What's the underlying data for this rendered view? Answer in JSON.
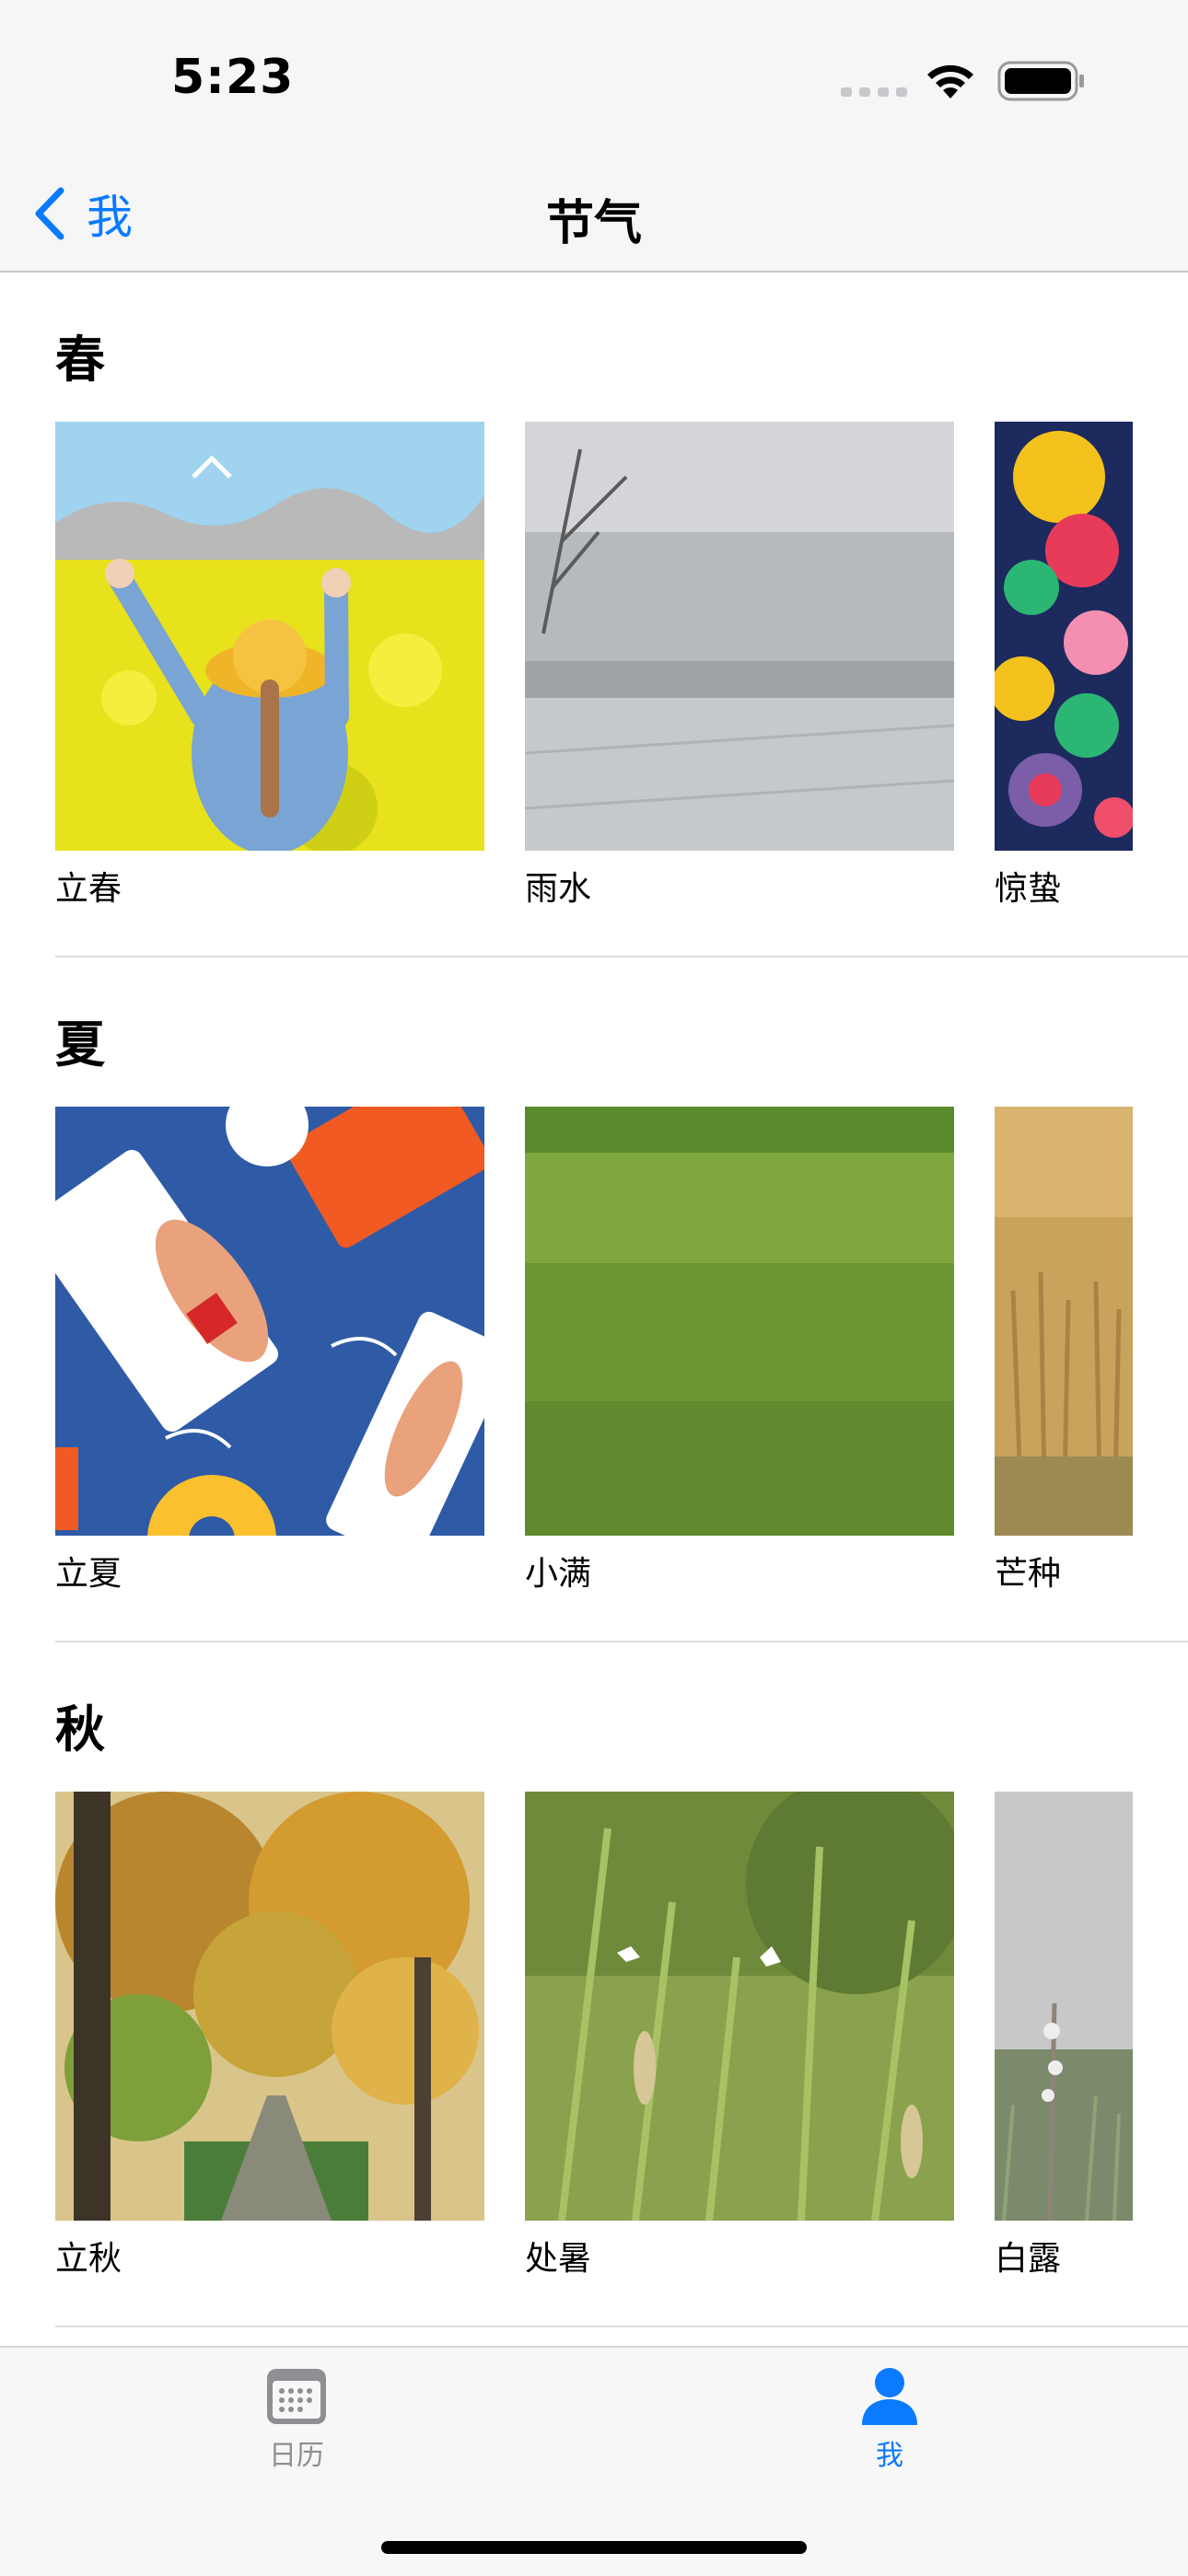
{
  "status_bar": {
    "time": "5:23"
  },
  "nav": {
    "back_label": "我",
    "title": "节气"
  },
  "sections": [
    {
      "title": "春",
      "items": [
        {
          "label": "立春",
          "icon": "girl-in-rapeseed-field-illustration"
        },
        {
          "label": "雨水",
          "icon": "misty-snowy-field-photo"
        },
        {
          "label": "惊蛰",
          "icon": "colorful-flower-insect-illustration"
        }
      ]
    },
    {
      "title": "夏",
      "items": [
        {
          "label": "立夏",
          "icon": "people-on-pool-floats-illustration"
        },
        {
          "label": "小满",
          "icon": "green-wheat-field-photo"
        },
        {
          "label": "芒种",
          "icon": "golden-wheat-stubble-photo"
        }
      ]
    },
    {
      "title": "秋",
      "items": [
        {
          "label": "立秋",
          "icon": "autumn-tree-lined-road-photo"
        },
        {
          "label": "处暑",
          "icon": "grass-with-butterflies-photo"
        },
        {
          "label": "白露",
          "icon": "dew-on-grass-photo"
        }
      ]
    }
  ],
  "tab_bar": {
    "tabs": [
      {
        "label": "日历",
        "icon": "calendar-icon",
        "active": false
      },
      {
        "label": "我",
        "icon": "person-icon",
        "active": true
      }
    ]
  },
  "colors": {
    "accent": "#0a7aff",
    "inactive_tab": "#8e8e93"
  }
}
